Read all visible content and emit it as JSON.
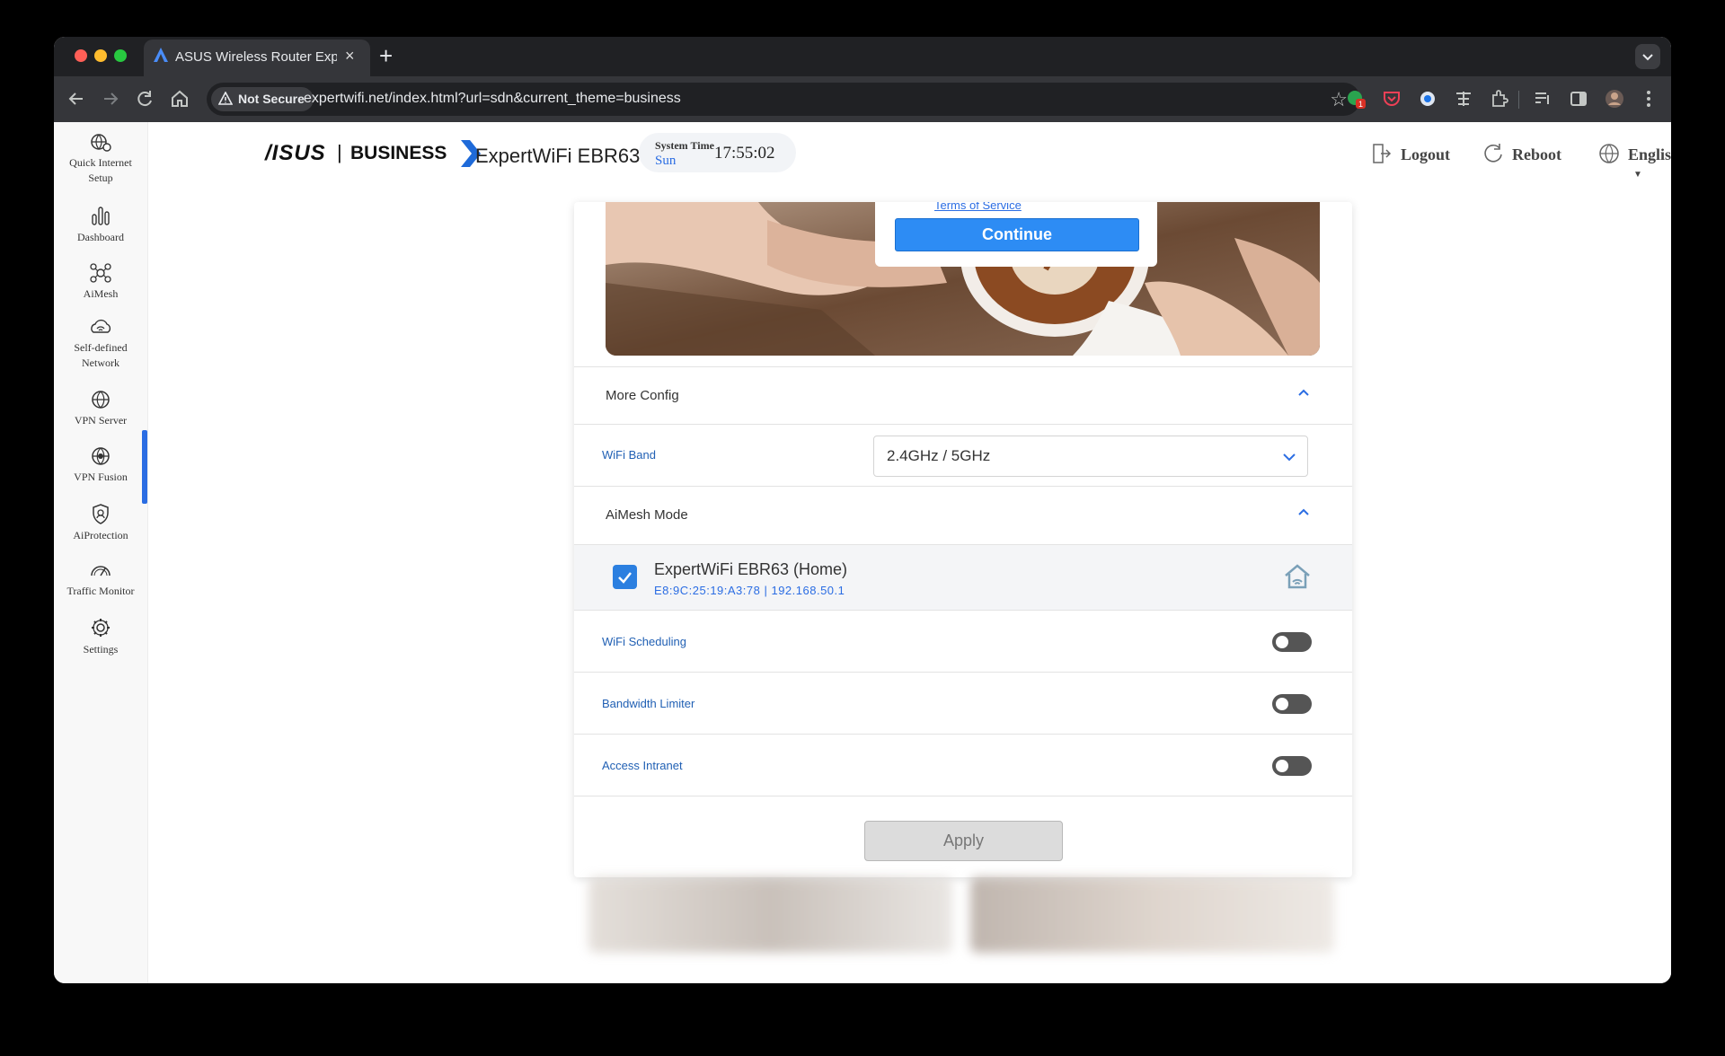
{
  "browser": {
    "tab_title": "ASUS Wireless Router Expert",
    "tab_close": "×",
    "new_tab": "+",
    "security_label": "Not Secure",
    "url": "expertwifi.net/index.html?url=sdn&current_theme=business",
    "extension_badge": "1"
  },
  "sidebar": {
    "items": [
      {
        "line1": "Quick Internet",
        "line2": "Setup",
        "icon": "globe-gear-icon"
      },
      {
        "line1": "Dashboard",
        "line2": "",
        "icon": "bar-chart-icon"
      },
      {
        "line1": "AiMesh",
        "line2": "",
        "icon": "mesh-icon"
      },
      {
        "line1": "Self-defined",
        "line2": "Network",
        "icon": "wifi-cloud-icon"
      },
      {
        "line1": "VPN Server",
        "line2": "",
        "icon": "vpn-globe-icon"
      },
      {
        "line1": "VPN Fusion",
        "line2": "",
        "icon": "vpn-fusion-icon"
      },
      {
        "line1": "AiProtection",
        "line2": "",
        "icon": "shield-icon"
      },
      {
        "line1": "Traffic Monitor",
        "line2": "",
        "icon": "gauge-icon"
      },
      {
        "line1": "Settings",
        "line2": "",
        "icon": "gear-icon"
      }
    ],
    "active_index": 3
  },
  "header": {
    "brand": "/ISUS",
    "divider": "|",
    "brand_line": "BUSINESS",
    "product": "ExpertWiFi EBR63",
    "system_time_label": "System Time",
    "day": "Sun",
    "time": "17:55:02",
    "logout": "Logout",
    "reboot": "Reboot",
    "language": "English"
  },
  "portal": {
    "terms_link": "Terms of Service",
    "continue": "Continue"
  },
  "more_config": {
    "title": "More Config",
    "wifi_band_label": "WiFi Band",
    "wifi_band_value": "2.4GHz / 5GHz"
  },
  "aimesh": {
    "title": "AiMesh Mode",
    "node_name": "ExpertWiFi EBR63 (Home)",
    "node_info": "E8:9C:25:19:A3:78 | 192.168.50.1",
    "checked": true
  },
  "toggles": [
    {
      "label": "WiFi Scheduling",
      "on": false
    },
    {
      "label": "Bandwidth Limiter",
      "on": false
    },
    {
      "label": "Access Intranet",
      "on": false
    }
  ],
  "apply": "Apply",
  "colors": {
    "accent": "#2b6de3",
    "continue_button": "#2d8cf4",
    "label_blue": "#2160b4",
    "toggle_off": "#555555"
  }
}
